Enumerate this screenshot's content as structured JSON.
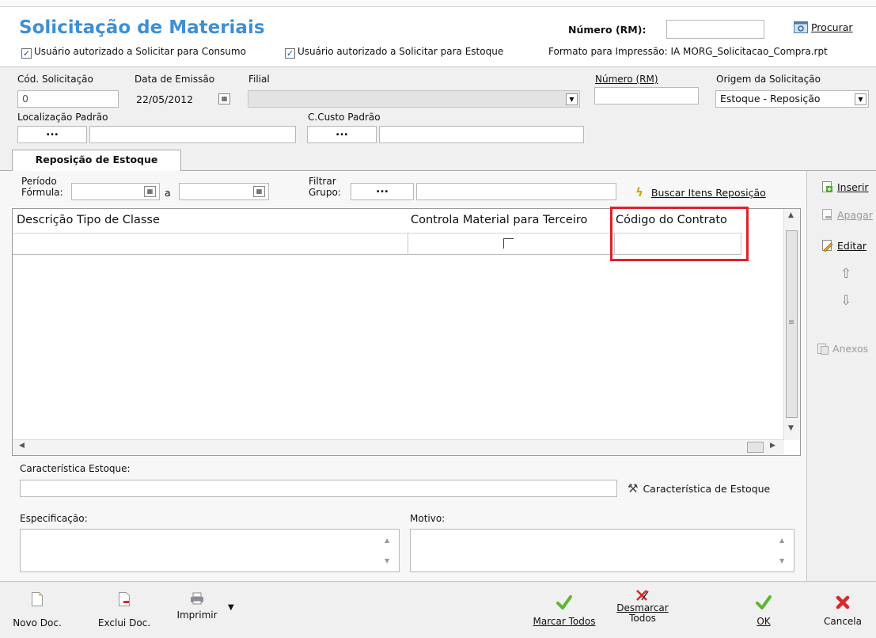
{
  "header": {
    "title": "Solicitação de Materiais",
    "check_consumo": "Usuário autorizado a Solicitar para Consumo",
    "check_estoque": "Usuário autorizado a Solicitar para Estoque",
    "numero_rm_label": "Número (RM):",
    "numero_rm_value": "",
    "procurar_label": "Procurar",
    "formato_impressao": "Formato para Impressão: IA MORG_Solicitacao_Compra.rpt"
  },
  "form": {
    "cod_solicitacao_label": "Cód. Solicitação",
    "cod_solicitacao_value": "0",
    "data_emissao_label": "Data de Emissão",
    "data_emissao_value": "22/05/2012",
    "filial_label": "Filial",
    "filial_value": "",
    "numero_rm_label": "Número (RM)",
    "numero_rm_value": "",
    "origem_label": "Origem da Solicitação",
    "origem_value": "Estoque - Reposição",
    "localizacao_label": "Localização Padrão",
    "ccusto_label": "C.Custo Padrão",
    "dots": "..."
  },
  "tab": {
    "label": "Reposição de Estoque"
  },
  "filters": {
    "periodo_label_1": "Período",
    "periodo_label_2": "Fórmula:",
    "a_label": "a",
    "filtrar_label_1": "Filtrar",
    "filtrar_label_2": "Grupo:",
    "buscar_label": "Buscar Itens Reposição"
  },
  "grid": {
    "columns": [
      "Descrição Tipo de Classe",
      "Controla Material para Terceiro",
      "Código do Contrato"
    ],
    "rows": [
      [
        "",
        "",
        ""
      ]
    ]
  },
  "side_actions": {
    "inserir": "Inserir",
    "apagar": "Apagar",
    "editar": "Editar",
    "anexos": "Anexos"
  },
  "bottom_form": {
    "caracteristica_label": "Característica Estoque:",
    "caracteristica_button": "Característica de Estoque",
    "especificacao_label": "Especificação:",
    "motivo_label": "Motivo:"
  },
  "toolbar": {
    "novo_doc": "Novo Doc.",
    "exclui_doc": "Exclui Doc.",
    "imprimir": "Imprimir",
    "marcar_todos": "Marcar Todos",
    "desmarcar_1": "Desmarcar",
    "desmarcar_2": "Todos",
    "ok": "OK",
    "cancela": "Cancela"
  },
  "colors": {
    "title_blue": "#3d8fd6",
    "highlight_red": "#e0202a",
    "green_check": "#5cb82d",
    "red_x": "#d8282a"
  }
}
